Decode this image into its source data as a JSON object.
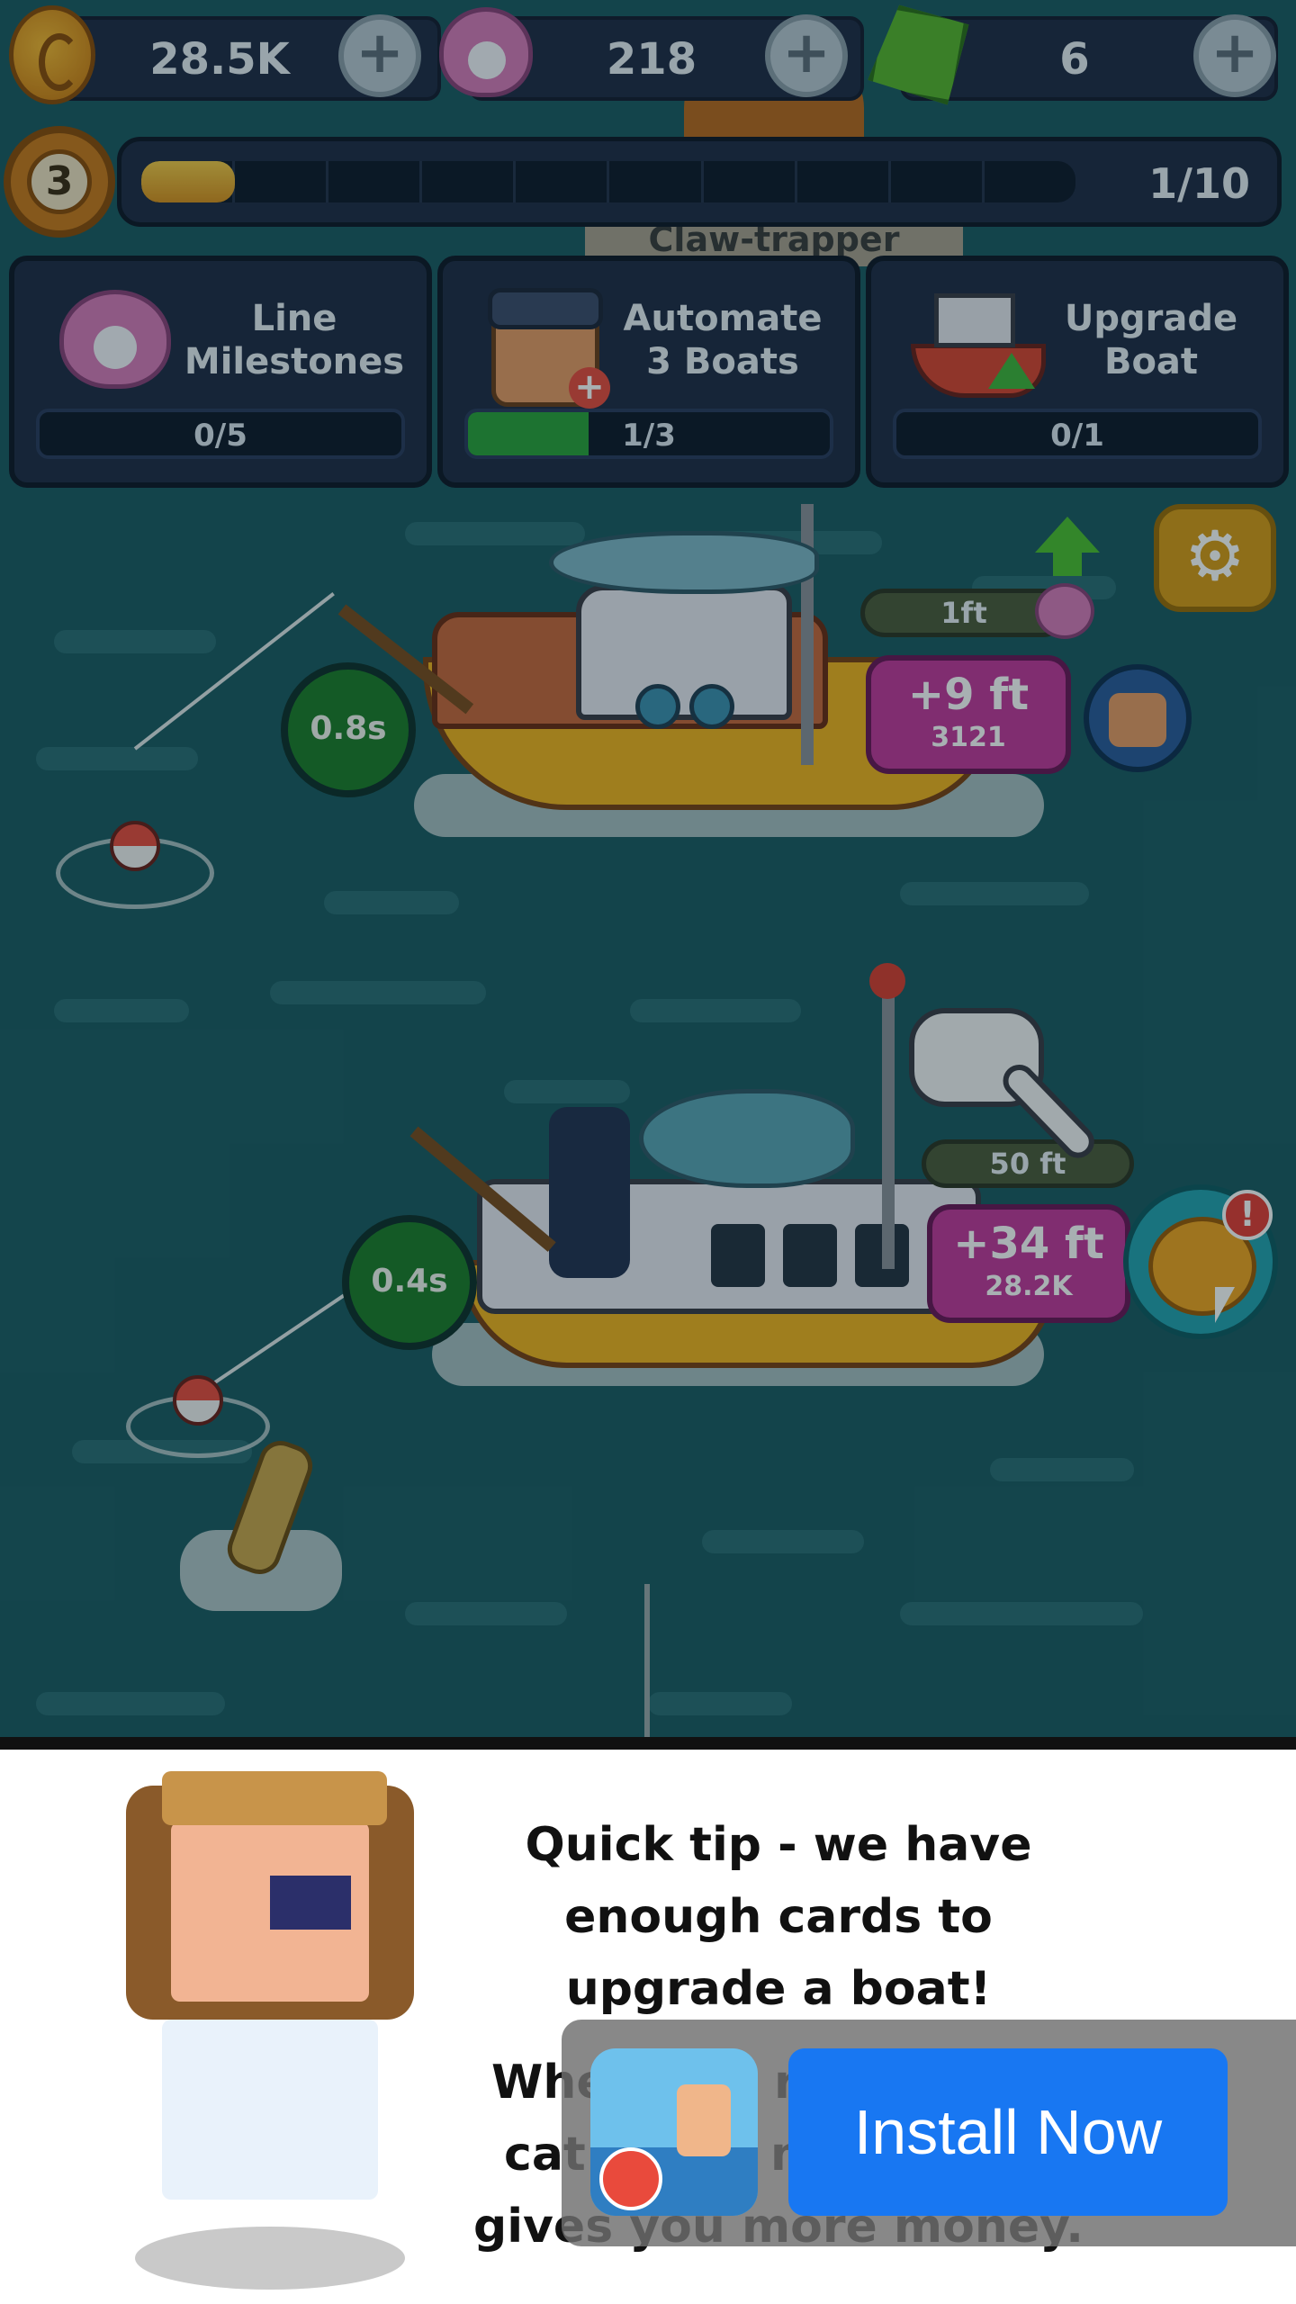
{
  "resources": {
    "coins": "28.5K",
    "pearls": "218",
    "gems": "6",
    "plus_label": "+"
  },
  "level": {
    "number": "3",
    "progress_text": "1/10",
    "progress_fraction": 0.1
  },
  "banner_partial_text": "Claw-trapper",
  "missions": [
    {
      "title_line1": "Line",
      "title_line2": "Milestones",
      "progress": "0/5",
      "fraction": 0
    },
    {
      "title_line1": "Automate",
      "title_line2": "3 Boats",
      "progress": "1/3",
      "fraction": 0.333
    },
    {
      "title_line1": "Upgrade",
      "title_line2": "Boat",
      "progress": "0/1",
      "fraction": 0
    }
  ],
  "boats": [
    {
      "timer": "0.8s",
      "depth": "1ft",
      "upgrade_main": "+9 ft",
      "upgrade_cost": "3121"
    },
    {
      "timer": "0.4s",
      "depth": "50 ft",
      "upgrade_main": "+34 ft",
      "upgrade_cost": "28.2K"
    }
  ],
  "alert_mark": "!",
  "tip": {
    "line1": "Quick tip - we have",
    "line2": "enough cards to",
    "line3": "upgrade a boat!",
    "line4": "Whe",
    "line4b": "r",
    "line5": "cat",
    "line5b": "m",
    "line6": "gives you more money."
  },
  "ad": {
    "install_label": "Install Now"
  },
  "colors": {
    "water": "#1b5a62",
    "panel": "#1f2a44",
    "badge_pink": "#c2379a",
    "timer_green": "#1c7b28",
    "install_blue": "#1877f2"
  }
}
